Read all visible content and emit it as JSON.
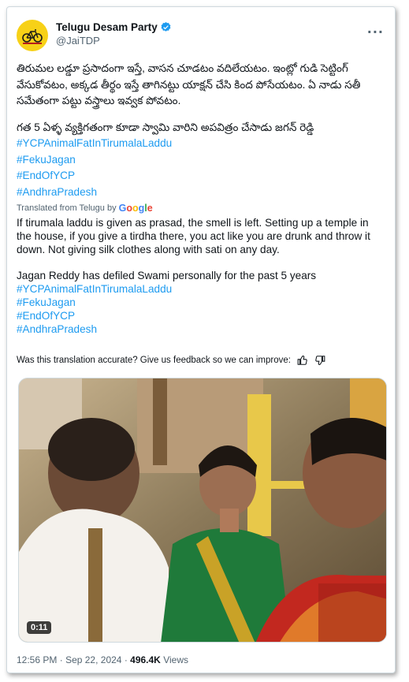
{
  "account": {
    "display_name": "Telugu Desam Party",
    "handle": "@JaiTDP",
    "verified_icon": "verified-badge-icon",
    "avatar_icon": "bicycle-logo-icon"
  },
  "menu_icon": "more-options-icon",
  "original": {
    "paragraph1": "తిరుమల లడ్డూ ప్రసాదంగా ఇస్తే, వాసన చూడటం వదిలేయటం. ఇంట్లో గుడి సెట్టింగ్ వేసుకోవటం, అక్కడ తీర్థం ఇస్తే తాగినట్టు యాక్షన్ చేసి కింద పోసేయటం. ఏ నాడు సతీ సమేతంగా పట్టు వస్త్రాలు ఇవ్వక పోవటం.",
    "paragraph2": "గత 5 ఏళ్ళ వ్యక్తిగతంగా కూడా స్వామి వారిని అపవిత్రం చేసాడు జగన్ రెడ్డి",
    "hashtags": [
      "#YCPAnimalFatInTirumalaLaddu",
      "#FekuJagan",
      "#EndOfYCP",
      "#AndhraPradesh"
    ]
  },
  "translation": {
    "label": "Translated from Telugu by",
    "provider": "Google",
    "paragraph1": "If tirumala laddu is given as prasad, the smell is left. Setting up a temple in the house, if you give a tirdha there, you act like you are drunk and throw it down. Not giving silk clothes along with sati on any day.",
    "paragraph2": "Jagan Reddy has defiled Swami personally for the past 5 years",
    "hashtags": [
      "#YCPAnimalFatInTirumalaLaddu",
      "#FekuJagan",
      "#EndOfYCP",
      "#AndhraPradesh"
    ]
  },
  "feedback": {
    "question": "Was this translation accurate? Give us feedback so we can improve:",
    "up_icon": "thumbs-up-icon",
    "down_icon": "thumbs-down-icon"
  },
  "video": {
    "duration": "0:11"
  },
  "meta": {
    "time": "12:56 PM",
    "separator": "·",
    "date": "Sep 22, 2024",
    "views_count": "496.4K",
    "views_label": "Views"
  },
  "colors": {
    "link": "#1d9bf0",
    "verified": "#1d9bf0",
    "avatar_bg": "#f7d117"
  }
}
